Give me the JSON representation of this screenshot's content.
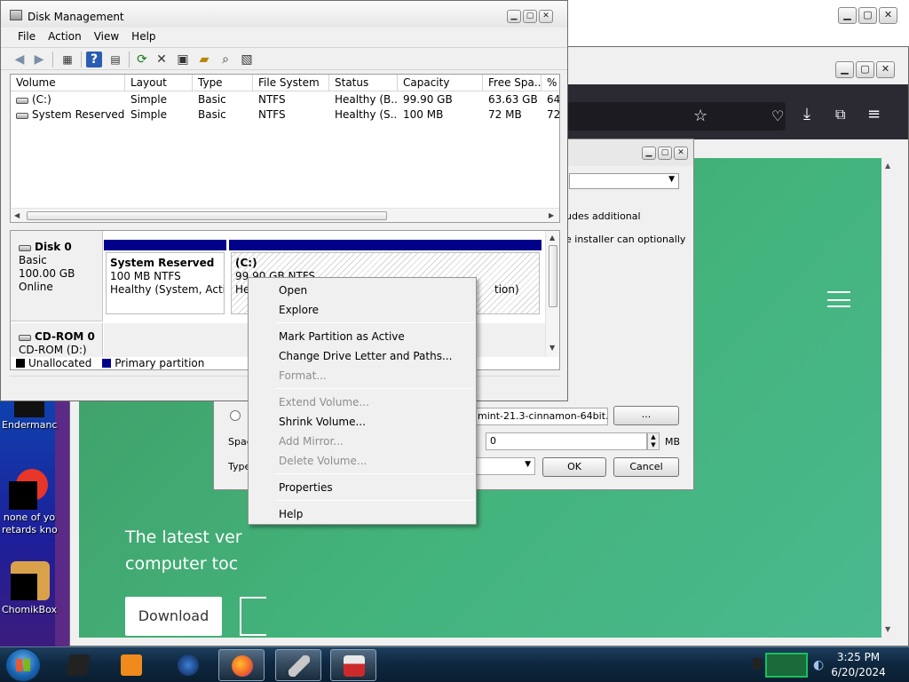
{
  "disk_management": {
    "title": "Disk Management",
    "menu": [
      "File",
      "Action",
      "View",
      "Help"
    ],
    "columns": [
      "Volume",
      "Layout",
      "Type",
      "File System",
      "Status",
      "Capacity",
      "Free Spa...",
      "%"
    ],
    "volumes": [
      {
        "volume": "(C:)",
        "layout": "Simple",
        "type": "Basic",
        "fs": "NTFS",
        "status": "Healthy (B...",
        "capacity": "99.90 GB",
        "free": "63.63 GB",
        "pct": "64"
      },
      {
        "volume": "System Reserved",
        "layout": "Simple",
        "type": "Basic",
        "fs": "NTFS",
        "status": "Healthy (S...",
        "capacity": "100 MB",
        "free": "72 MB",
        "pct": "72"
      }
    ],
    "disk0": {
      "name": "Disk 0",
      "kind": "Basic",
      "size": "100.00 GB",
      "state": "Online"
    },
    "partitions": {
      "system_reserved": {
        "name": "System Reserved",
        "size_fs": "100 MB NTFS",
        "status": "Healthy (System, Active"
      },
      "c": {
        "name": "(C:)",
        "size_fs": "99.90 GB NTFS",
        "status_start": "He",
        "status_end": "tion)"
      }
    },
    "cdrom": {
      "name": "CD-ROM 0",
      "drive": "CD-ROM (D:)"
    },
    "legend": {
      "unallocated": "Unallocated",
      "primary": "Primary partition",
      "unallocated_color": "#000000",
      "primary_color": "#00008b"
    }
  },
  "context_menu": {
    "items": [
      {
        "label": "Open",
        "enabled": true
      },
      {
        "label": "Explore",
        "enabled": true
      },
      {
        "label": "Mark Partition as Active",
        "enabled": true
      },
      {
        "label": "Change Drive Letter and Paths...",
        "enabled": true
      },
      {
        "label": "Format...",
        "enabled": false
      },
      {
        "label": "Extend Volume...",
        "enabled": false
      },
      {
        "label": "Shrink Volume...",
        "enabled": true
      },
      {
        "label": "Add Mirror...",
        "enabled": false
      },
      {
        "label": "Delete Volume...",
        "enabled": false
      },
      {
        "label": "Properties",
        "enabled": true
      },
      {
        "label": "Help",
        "enabled": true
      }
    ]
  },
  "installer": {
    "text1": "udes additional",
    "text2": "e installer can optionally",
    "iso_value": "mint-21.3-cinnamon-64bit.iso",
    "browse_label": "...",
    "space_label": "Spac",
    "space_value": "0",
    "space_unit": "MB",
    "type_label": "Type",
    "ok_label": "OK",
    "cancel_label": "Cancel"
  },
  "browser": {
    "hero_line1": "The latest ver",
    "hero_line2": "computer toc",
    "download_label": "Download",
    "accent_color": "#43b37b"
  },
  "desktop": {
    "icons": [
      "Endermanc",
      "none of yo\nretards kno",
      "ChomikBox"
    ]
  },
  "taskbar": {
    "time": "3:25 PM",
    "date": "6/20/2024"
  }
}
